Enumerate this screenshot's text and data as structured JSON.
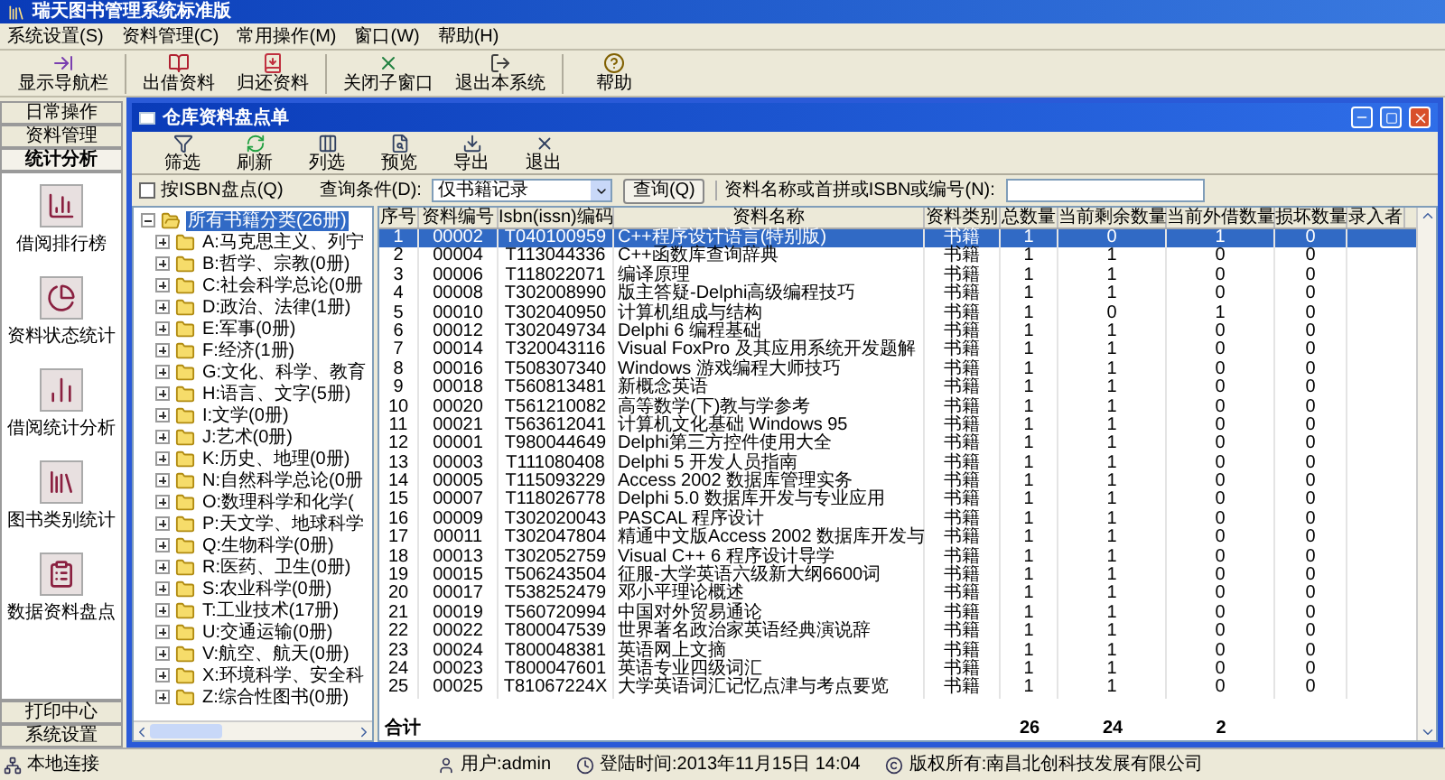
{
  "window": {
    "title": "瑞天图书管理系统标准版"
  },
  "menu": [
    "系统设置(S)",
    "资料管理(C)",
    "常用操作(M)",
    "窗口(W)",
    "帮助(H)"
  ],
  "toolbar": [
    "显示导航栏",
    "出借资料",
    "归还资料",
    "关闭子窗口",
    "退出本系统",
    "帮助"
  ],
  "sidebar": {
    "top_tabs": [
      {
        "label": "日常操作",
        "selected": false
      },
      {
        "label": "资料管理",
        "selected": false
      },
      {
        "label": "统计分析",
        "selected": true
      }
    ],
    "items": [
      "借阅排行榜",
      "资料状态统计",
      "借阅统计分析",
      "图书类别统计",
      "数据资料盘点"
    ],
    "bottom_tabs": [
      {
        "label": "打印中心",
        "selected": false
      },
      {
        "label": "系统设置",
        "selected": false
      }
    ]
  },
  "child_window": {
    "title": "仓库资料盘点单",
    "toolbar": [
      "筛选",
      "刷新",
      "列选",
      "预览",
      "导出",
      "退出"
    ],
    "filter": {
      "checkbox": {
        "label": "按ISBN盘点(Q)",
        "checked": false
      },
      "condition_label": "查询条件(D):",
      "condition_value": "仅书籍记录",
      "query_button": "查询(Q)",
      "search_label": "资料名称或首拼或ISBN或编号(N):"
    },
    "tree": {
      "label": "所有书籍分类(26册)",
      "selected": true,
      "expanded": true,
      "children": [
        {
          "label": "A:马克思主义、列宁",
          "selected": false,
          "expanded": false
        },
        {
          "label": "B:哲学、宗教(0册)",
          "selected": false,
          "expanded": false
        },
        {
          "label": "C:社会科学总论(0册",
          "selected": false,
          "expanded": false
        },
        {
          "label": "D:政治、法律(1册)",
          "selected": false,
          "expanded": false
        },
        {
          "label": "E:军事(0册)",
          "selected": false,
          "expanded": false
        },
        {
          "label": "F:经济(1册)",
          "selected": false,
          "expanded": false
        },
        {
          "label": "G:文化、科学、教育",
          "selected": false,
          "expanded": false
        },
        {
          "label": "H:语言、文字(5册)",
          "selected": false,
          "expanded": false
        },
        {
          "label": "I:文学(0册)",
          "selected": false,
          "expanded": false
        },
        {
          "label": "J:艺术(0册)",
          "selected": false,
          "expanded": false
        },
        {
          "label": "K:历史、地理(0册)",
          "selected": false,
          "expanded": false
        },
        {
          "label": "N:自然科学总论(0册",
          "selected": false,
          "expanded": false
        },
        {
          "label": "O:数理科学和化学(",
          "selected": false,
          "expanded": false
        },
        {
          "label": "P:天文学、地球科学",
          "selected": false,
          "expanded": false
        },
        {
          "label": "Q:生物科学(0册)",
          "selected": false,
          "expanded": false
        },
        {
          "label": "R:医药、卫生(0册)",
          "selected": false,
          "expanded": false
        },
        {
          "label": "S:农业科学(0册)",
          "selected": false,
          "expanded": false
        },
        {
          "label": "T:工业技术(17册)",
          "selected": false,
          "expanded": false
        },
        {
          "label": "U:交通运输(0册)",
          "selected": false,
          "expanded": false
        },
        {
          "label": "V:航空、航天(0册)",
          "selected": false,
          "expanded": false
        },
        {
          "label": "X:环境科学、安全科",
          "selected": false,
          "expanded": false
        },
        {
          "label": "Z:综合性图书(0册)",
          "selected": false,
          "expanded": false
        }
      ]
    },
    "table": {
      "columns": [
        "序号",
        "资料编号",
        "Isbn(issn)编码",
        "资料名称",
        "资料类别",
        "总数量",
        "当前剩余数量",
        "当前外借数量",
        "损坏数量",
        "录入者"
      ],
      "rows": [
        {
          "selected": true,
          "cells": [
            "1",
            "00002",
            "T040100959",
            "C++程序设计语言(特别版)",
            "书籍",
            "1",
            "0",
            "1",
            "0"
          ]
        },
        {
          "selected": false,
          "cells": [
            "2",
            "00004",
            "T113044336",
            "C++函数库查询辞典",
            "书籍",
            "1",
            "1",
            "0",
            "0"
          ]
        },
        {
          "selected": false,
          "cells": [
            "3",
            "00006",
            "T118022071",
            "编译原理",
            "书籍",
            "1",
            "1",
            "0",
            "0"
          ]
        },
        {
          "selected": false,
          "cells": [
            "4",
            "00008",
            "T302008990",
            "版主答疑-Delphi高级编程技巧",
            "书籍",
            "1",
            "1",
            "0",
            "0"
          ]
        },
        {
          "selected": false,
          "cells": [
            "5",
            "00010",
            "T302040950",
            "计算机组成与结构",
            "书籍",
            "1",
            "0",
            "1",
            "0"
          ]
        },
        {
          "selected": false,
          "cells": [
            "6",
            "00012",
            "T302049734",
            "Delphi 6 编程基础",
            "书籍",
            "1",
            "1",
            "0",
            "0"
          ]
        },
        {
          "selected": false,
          "cells": [
            "7",
            "00014",
            "T320043116",
            "Visual FoxPro 及其应用系统开发题解",
            "书籍",
            "1",
            "1",
            "0",
            "0"
          ]
        },
        {
          "selected": false,
          "cells": [
            "8",
            "00016",
            "T508307340",
            "Windows 游戏编程大师技巧",
            "书籍",
            "1",
            "1",
            "0",
            "0"
          ]
        },
        {
          "selected": false,
          "cells": [
            "9",
            "00018",
            "T560813481",
            "新概念英语",
            "书籍",
            "1",
            "1",
            "0",
            "0"
          ]
        },
        {
          "selected": false,
          "cells": [
            "10",
            "00020",
            "T561210082",
            "高等数学(下)教与学参考",
            "书籍",
            "1",
            "1",
            "0",
            "0"
          ]
        },
        {
          "selected": false,
          "cells": [
            "11",
            "00021",
            "T563612041",
            "计算机文化基础 Windows 95",
            "书籍",
            "1",
            "1",
            "0",
            "0"
          ]
        },
        {
          "selected": false,
          "cells": [
            "12",
            "00001",
            "T980044649",
            "Delphi第三方控件使用大全",
            "书籍",
            "1",
            "1",
            "0",
            "0"
          ]
        },
        {
          "selected": false,
          "cells": [
            "13",
            "00003",
            "T111080408",
            "Delphi 5 开发人员指南",
            "书籍",
            "1",
            "1",
            "0",
            "0"
          ]
        },
        {
          "selected": false,
          "cells": [
            "14",
            "00005",
            "T115093229",
            "Access 2002 数据库管理实务",
            "书籍",
            "1",
            "1",
            "0",
            "0"
          ]
        },
        {
          "selected": false,
          "cells": [
            "15",
            "00007",
            "T118026778",
            "Delphi 5.0 数据库开发与专业应用",
            "书籍",
            "1",
            "1",
            "0",
            "0"
          ]
        },
        {
          "selected": false,
          "cells": [
            "16",
            "00009",
            "T302020043",
            "PASCAL 程序设计",
            "书籍",
            "1",
            "1",
            "0",
            "0"
          ]
        },
        {
          "selected": false,
          "cells": [
            "17",
            "00011",
            "T302047804",
            "精通中文版Access 2002 数据库开发与",
            "书籍",
            "1",
            "1",
            "0",
            "0"
          ]
        },
        {
          "selected": false,
          "cells": [
            "18",
            "00013",
            "T302052759",
            "Visual C++ 6 程序设计导学",
            "书籍",
            "1",
            "1",
            "0",
            "0"
          ]
        },
        {
          "selected": false,
          "cells": [
            "19",
            "00015",
            "T506243504",
            "征服-大学英语六级新大纲6600词",
            "书籍",
            "1",
            "1",
            "0",
            "0"
          ]
        },
        {
          "selected": false,
          "cells": [
            "20",
            "00017",
            "T538252479",
            "邓小平理论概述",
            "书籍",
            "1",
            "1",
            "0",
            "0"
          ]
        },
        {
          "selected": false,
          "cells": [
            "21",
            "00019",
            "T560720994",
            "中国对外贸易通论",
            "书籍",
            "1",
            "1",
            "0",
            "0"
          ]
        },
        {
          "selected": false,
          "cells": [
            "22",
            "00022",
            "T800047539",
            "世界著名政治家英语经典演说辞",
            "书籍",
            "1",
            "1",
            "0",
            "0"
          ]
        },
        {
          "selected": false,
          "cells": [
            "23",
            "00024",
            "T800048381",
            "英语网上文摘",
            "书籍",
            "1",
            "1",
            "0",
            "0"
          ]
        },
        {
          "selected": false,
          "cells": [
            "24",
            "00023",
            "T800047601",
            "英语专业四级词汇",
            "书籍",
            "1",
            "1",
            "0",
            "0"
          ]
        },
        {
          "selected": false,
          "cells": [
            "25",
            "00025",
            "T81067224X",
            "大学英语词汇记忆点津与考点要览",
            "书籍",
            "1",
            "1",
            "0",
            "0"
          ]
        }
      ],
      "total": {
        "label": "合计",
        "values": [
          "26",
          "24",
          "2"
        ]
      }
    }
  },
  "status_bar": [
    "本地连接",
    "用户:admin",
    "登陆时间:2013年11月15日 14:04",
    "版权所有:南昌北创科技发展有限公司"
  ]
}
